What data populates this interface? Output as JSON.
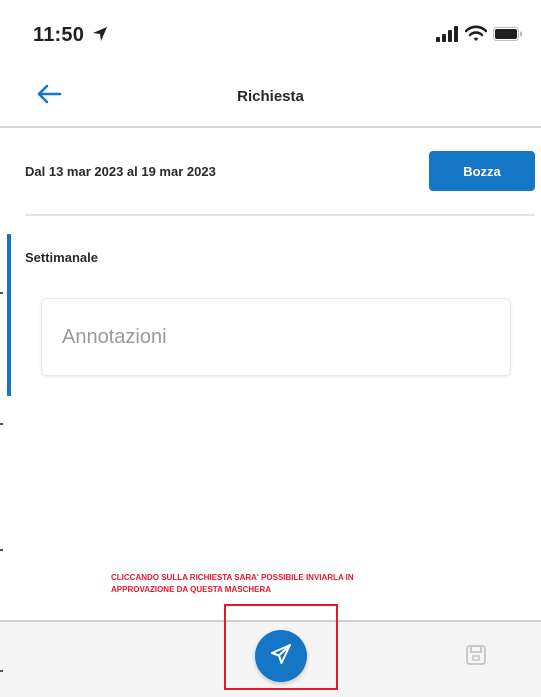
{
  "status_bar": {
    "time": "11:50",
    "icons": [
      "location-arrow-icon",
      "cellular-signal-icon",
      "wifi-icon",
      "battery-icon"
    ]
  },
  "header": {
    "back_icon": "arrow-left-icon",
    "title": "Richiesta"
  },
  "request": {
    "period": "Dal 13 mar 2023 al 19 mar 2023",
    "status_label": "Bozza"
  },
  "section": {
    "title": "Settimanale",
    "notes_placeholder": "Annotazioni",
    "notes_value": ""
  },
  "annotation": {
    "line1": "CLICCANDO SULLA RICHIESTA SARA' POSSIBILE INVIARLA IN",
    "line2": "APPROVAZIONE DA QUESTA MASCHERA"
  },
  "bottom_bar": {
    "send_icon": "send-icon",
    "save_icon": "save-icon"
  },
  "colors": {
    "accent": "#1576c5",
    "annotation_red": "#e8182a",
    "divider": "#e4e4e4"
  }
}
